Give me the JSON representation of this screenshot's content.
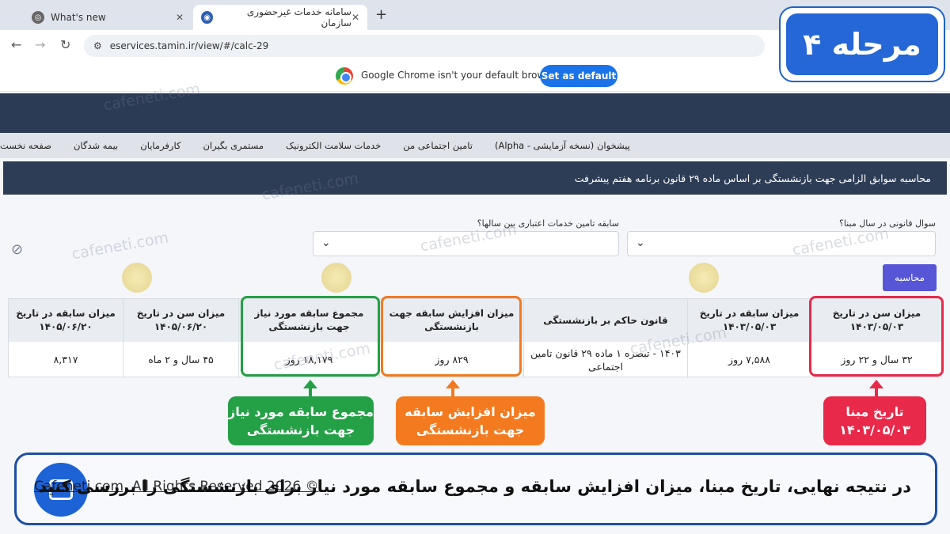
{
  "browser": {
    "tabs": [
      {
        "title": "What's new"
      },
      {
        "title": "سامانه خدمات غیرحضوری سازمان"
      }
    ],
    "url": "eservices.tamin.ir/view/#/calc-29",
    "default_bar_text": "Google Chrome isn't your default browser",
    "default_button": "Set as default"
  },
  "nav": {
    "items": [
      "صفحه نخست",
      "بیمه شدگان",
      "کارفرمایان",
      "مستمری بگیران",
      "خدمات سلامت الکترونیک",
      "تامین اجتماعی من",
      "پیشخوان (نسخه آزمایشی - Alpha)"
    ]
  },
  "page": {
    "title": "محاسبه سوابق الزامی جهت بازنشستگی بر اساس ماده ۲۹ قانون برنامه هفتم پیشرفت",
    "q1_label": "سوال قانونی در سال مبنا؟",
    "q2_label": "سابقه تامین خدمات اعتباری بین سالها؟",
    "calc_button": "محاسبه"
  },
  "table": {
    "columns": [
      {
        "header": "میزان سن در تاریخ ۱۴۰۳/۰۵/۰۳",
        "value": "۳۲ سال و ۲۲ روز"
      },
      {
        "header": "میزان سابقه در تاریخ ۱۴۰۳/۰۵/۰۳",
        "value": "۷,۵۸۸ روز"
      },
      {
        "header": "قانون حاکم بر بازنشستگی",
        "value": "۱۴۰۳ - تبصره ۱ ماده ۲۹ قانون تامین اجتماعی"
      },
      {
        "header": "میزان افزایش سابقه جهت بازنشستگی",
        "value": "۸۲۹ روز"
      },
      {
        "header": "مجموع سابقه مورد نیاز جهت بازنشستگی",
        "value": "۱۸,۱۷۹ روز"
      },
      {
        "header": "میزان سن در تاریخ ۱۴۰۵/۰۶/۲۰",
        "value": "۴۵ سال و ۲ ماه"
      },
      {
        "header": "میزان سابقه در تاریخ ۱۴۰۵/۰۶/۲۰",
        "value": "۸,۳۱۷"
      }
    ]
  },
  "callouts": {
    "red": "تاریخ مبنا ۱۴۰۳/۰۵/۰۳",
    "orange": "میزان افزایش سابقه جهت بازنشستگی",
    "green": "مجموع سابقه مورد نیاز جهت بازنشستگی"
  },
  "stage": "مرحله ۴",
  "footer": {
    "text": "در نتیجه نهایی، تاریخ مبنا، میزان افزایش سابقه و مجموع سابقه مورد نیاز برای بازنشستگی را بررسی کنید",
    "copyright": "Cafeneti.com, All Rights Reserved 2026 ©"
  },
  "watermark": "cafeneti.com",
  "colors": {
    "red": "#e8294a",
    "orange": "#f37a1f",
    "green": "#24a046",
    "navy": "#2b3a55",
    "blue": "#2567d6"
  }
}
